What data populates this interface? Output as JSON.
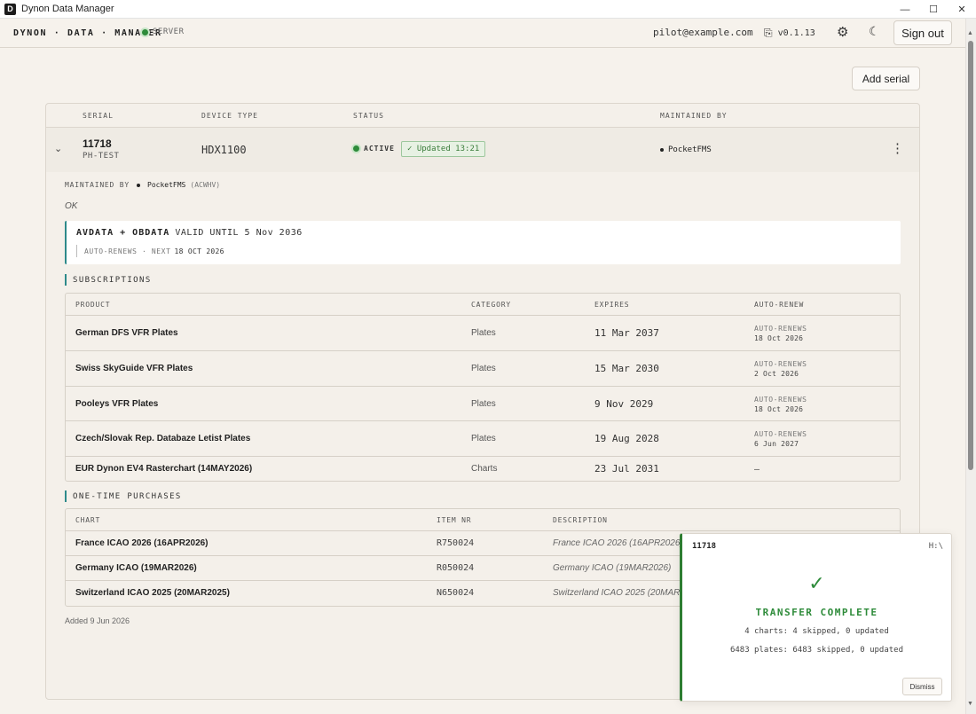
{
  "window": {
    "title": "Dynon Data Manager",
    "icon_letter": "D",
    "minimize": "—",
    "maximize": "☐",
    "close": "✕"
  },
  "header": {
    "brand": "DYNON · DATA · MANAGER",
    "server_label": "SERVER",
    "email": "pilot@example.com",
    "version": "v0.1.13",
    "signout": "Sign out"
  },
  "toolbar": {
    "add_serial": "Add serial"
  },
  "device_table": {
    "headers": {
      "serial": "SERIAL",
      "device_type": "DEVICE TYPE",
      "status": "STATUS",
      "maintained_by": "MAINTAINED BY"
    },
    "row": {
      "serial": "11718",
      "registration": "PH-TEST",
      "device_type": "HDX1100",
      "status": "ACTIVE",
      "updated": "✓ Updated 13:21",
      "maintained_by": "PocketFMS"
    }
  },
  "details": {
    "maintained_label": "MAINTAINED BY",
    "maintained_value": "PocketFMS",
    "maintained_code": "(ACWHV)",
    "ok_text": "OK",
    "plan": {
      "title": "AVDATA + OBDATA",
      "valid": "VALID UNTIL 5 Nov 2036",
      "renew_label": "AUTO-RENEWS · NEXT",
      "renew_date": "18 OCT 2026"
    },
    "subscriptions_title": "SUBSCRIPTIONS",
    "subscriptions": {
      "headers": {
        "product": "PRODUCT",
        "category": "CATEGORY",
        "expires": "EXPIRES",
        "auto_renew": "AUTO-RENEW"
      },
      "rows": [
        {
          "product": "German DFS VFR Plates",
          "category": "Plates",
          "expires": "11 Mar 2037",
          "renew_label": "AUTO-RENEWS",
          "renew_date": "18 Oct 2026"
        },
        {
          "product": "Swiss SkyGuide VFR Plates",
          "category": "Plates",
          "expires": "15 Mar 2030",
          "renew_label": "AUTO-RENEWS",
          "renew_date": "2 Oct 2026"
        },
        {
          "product": "Pooleys VFR Plates",
          "category": "Plates",
          "expires": "9 Nov 2029",
          "renew_label": "AUTO-RENEWS",
          "renew_date": "18 Oct 2026"
        },
        {
          "product": "Czech/Slovak Rep. Databaze Letist Plates",
          "category": "Plates",
          "expires": "19 Aug 2028",
          "renew_label": "AUTO-RENEWS",
          "renew_date": "6 Jun 2027"
        },
        {
          "product": "EUR Dynon EV4 Rasterchart (14MAY2026)",
          "category": "Charts",
          "expires": "23 Jul 2031",
          "renew_label": "—",
          "renew_date": ""
        }
      ]
    },
    "purchases_title": "ONE-TIME PURCHASES",
    "purchases": {
      "headers": {
        "chart": "CHART",
        "item_nr": "ITEM NR",
        "description": "DESCRIPTION"
      },
      "rows": [
        {
          "chart": "France ICAO 2026 (16APR2026)",
          "item": "R750024",
          "description": "France ICAO 2026 (16APR2026)"
        },
        {
          "chart": "Germany ICAO (19MAR2026)",
          "item": "R050024",
          "description": "Germany ICAO (19MAR2026)"
        },
        {
          "chart": "Switzerland ICAO 2025 (20MAR2025)",
          "item": "N650024",
          "description": "Switzerland ICAO 2025 (20MAR2025)"
        }
      ]
    },
    "added": "Added 9 Jun 2026"
  },
  "toast": {
    "serial": "11718",
    "drive": "H:\\",
    "title": "TRANSFER COMPLETE",
    "line1": "4 charts: 4 skipped, 0 updated",
    "line2": "6483 plates: 6483 skipped, 0 updated",
    "dismiss": "Dismiss"
  },
  "icons": {
    "chevron": "chevron-down-icon",
    "kebab": "more-vertical-icon",
    "gear": "gear-icon",
    "moon": "moon-icon",
    "version": "scroll-icon",
    "check": "check-icon"
  },
  "colors": {
    "accent_teal": "#2d8a8a",
    "success_green": "#2e8b3a",
    "background": "#f6f2ec"
  }
}
